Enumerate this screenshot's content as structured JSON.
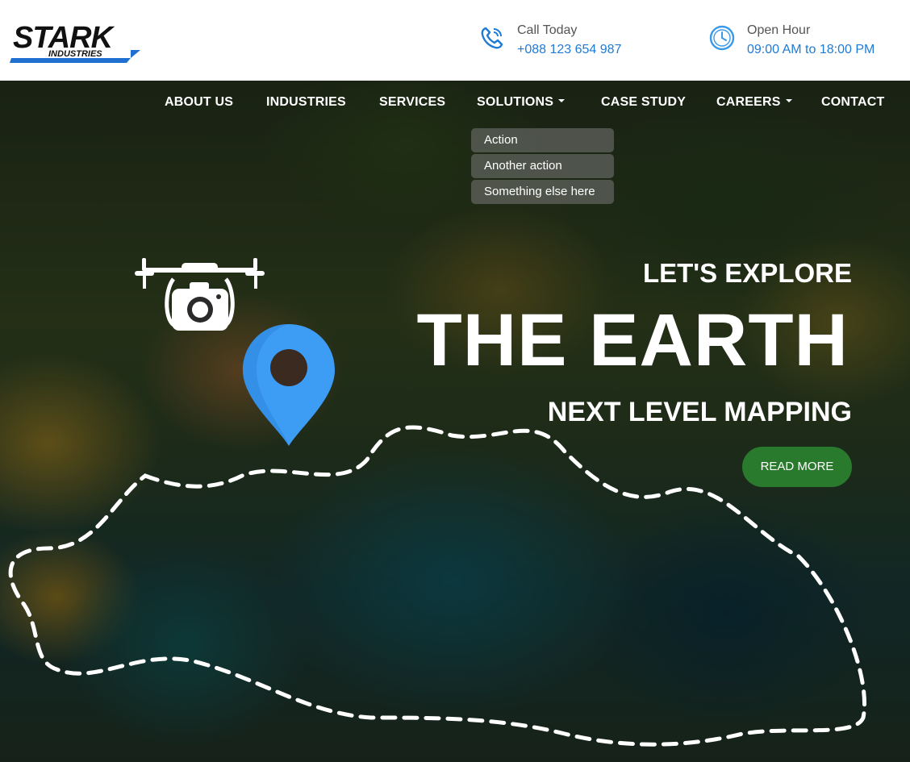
{
  "header": {
    "logo": {
      "primary": "STARK",
      "secondary": "INDUSTRIES"
    },
    "call": {
      "label": "Call Today",
      "value": "+088 123 654 987",
      "icon": "phone-icon"
    },
    "hours": {
      "label": "Open Hour",
      "value": "09:00 AM to 18:00 PM",
      "icon": "clock-icon"
    }
  },
  "nav": {
    "items": [
      {
        "label": "ABOUT US",
        "dropdown": false
      },
      {
        "label": "INDUSTRIES",
        "dropdown": false
      },
      {
        "label": "SERVICES",
        "dropdown": false
      },
      {
        "label": "SOLUTIONS",
        "dropdown": true
      },
      {
        "label": "CASE STUDY",
        "dropdown": false
      },
      {
        "label": "CAREERS",
        "dropdown": true
      },
      {
        "label": "CONTACT",
        "dropdown": false
      }
    ],
    "solutions_dropdown": [
      "Action",
      "Another action",
      "Something else here"
    ]
  },
  "hero": {
    "kicker": "LET'S EXPLORE",
    "headline": "THE EARTH",
    "subline": "NEXT LEVEL MAPPING",
    "cta": "READ MORE",
    "icons": [
      "drone-camera-icon",
      "map-pin-icon"
    ]
  },
  "colors": {
    "accent_blue": "#1e7bd7",
    "cta_green": "#2a7a2e",
    "pin_blue": "#3d9df5"
  }
}
